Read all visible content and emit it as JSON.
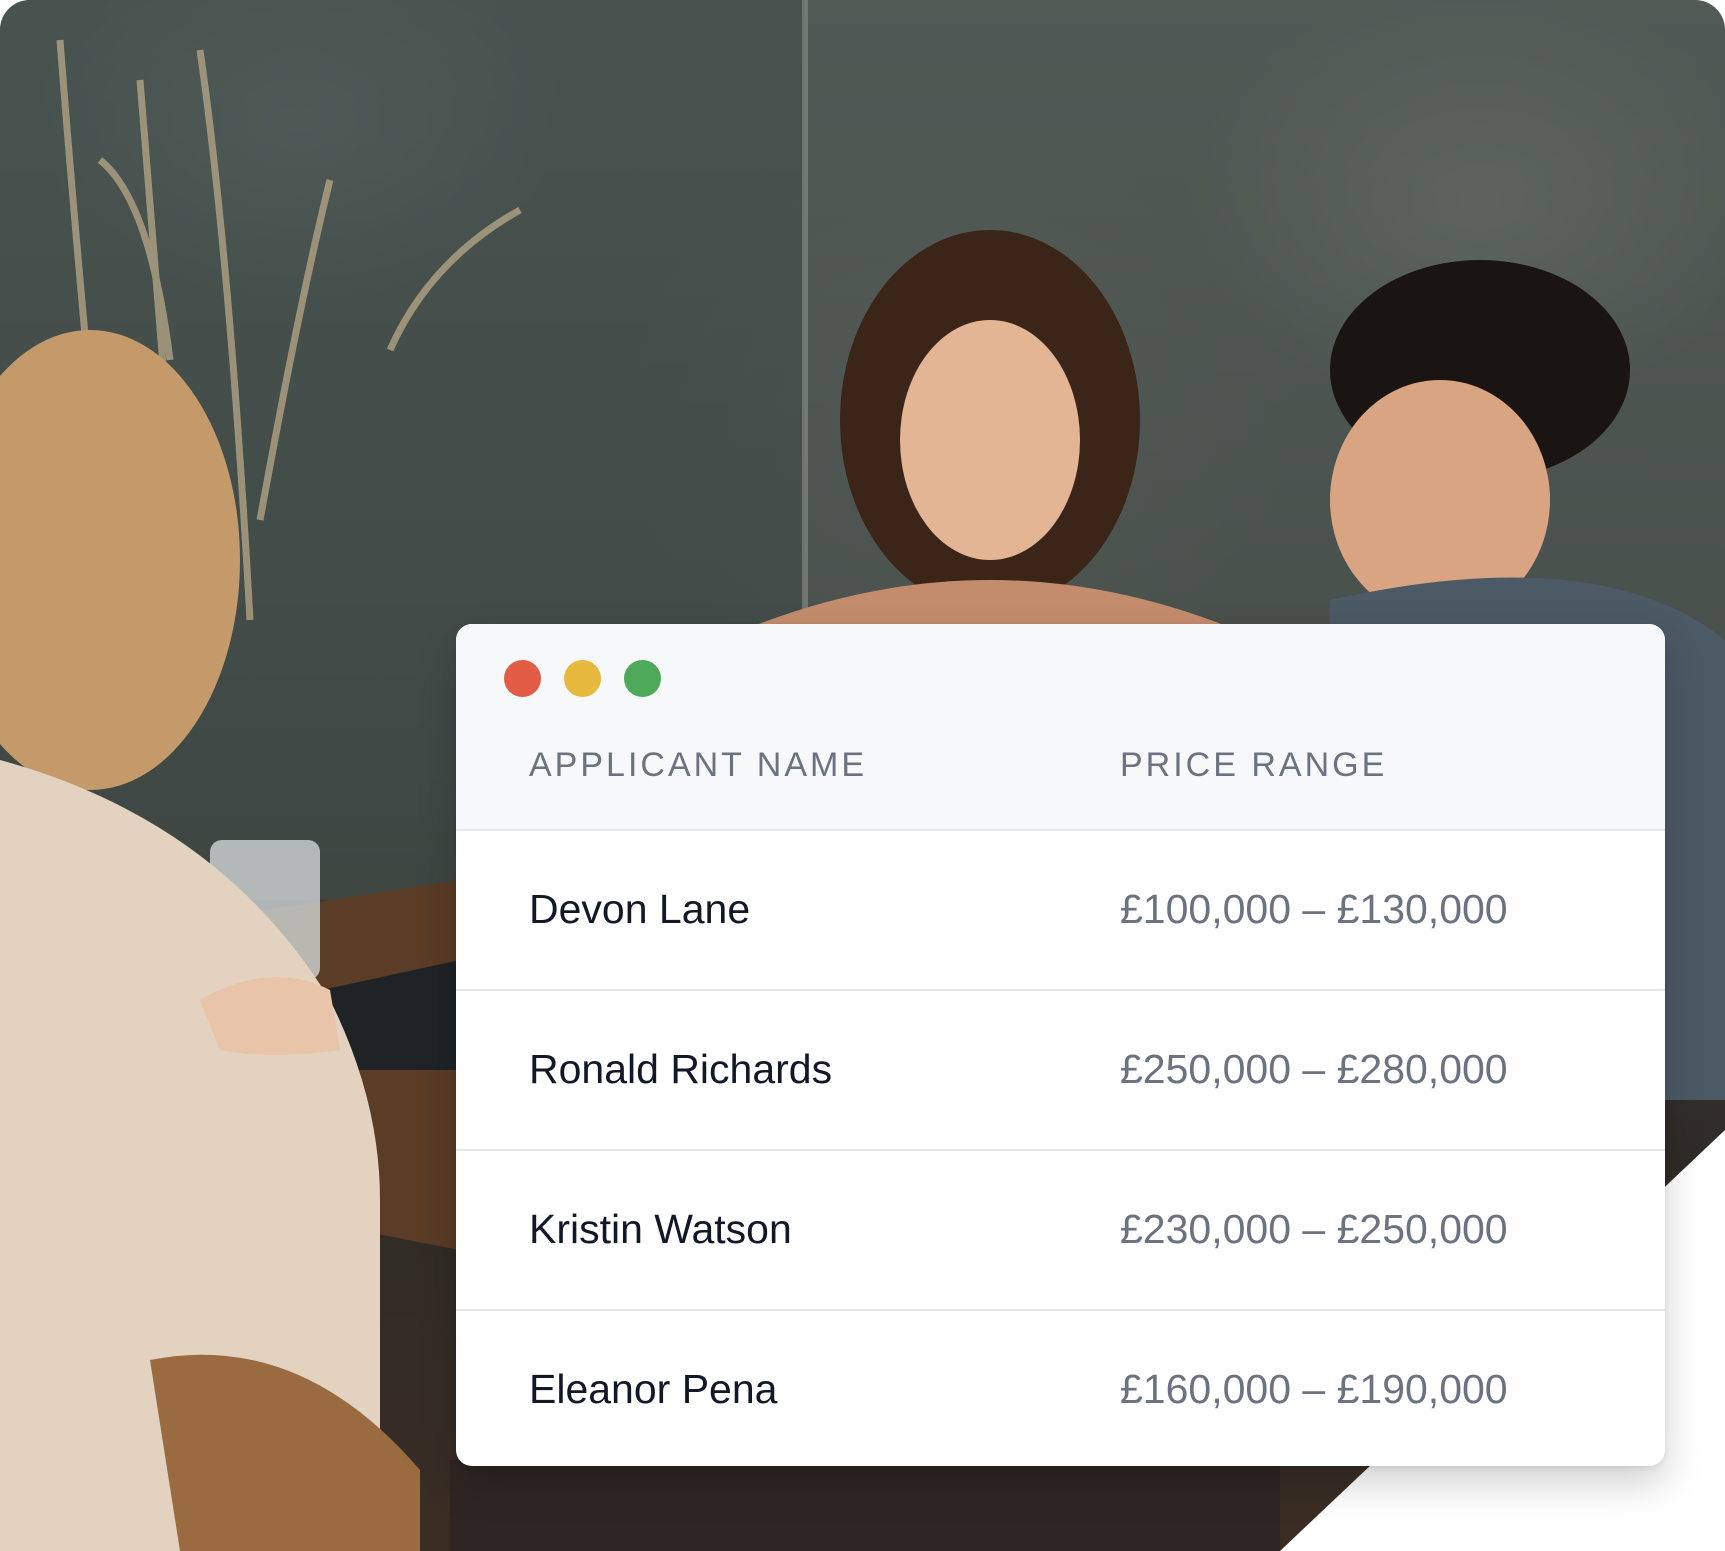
{
  "window": {
    "controls": {
      "close_color": "#e35c45",
      "minimize_color": "#e8b93f",
      "maximize_color": "#4fa95a"
    }
  },
  "table": {
    "columns": [
      "APPLICANT NAME",
      "PRICE RANGE"
    ],
    "rows": [
      {
        "name": "Devon Lane",
        "price_range": "£100,000 – £130,000"
      },
      {
        "name": "Ronald Richards",
        "price_range": "£250,000 – £280,000"
      },
      {
        "name": "Kristin Watson",
        "price_range": "£230,000 – £250,000"
      },
      {
        "name": "Eleanor Pena",
        "price_range": "£160,000 – £190,000"
      }
    ]
  }
}
